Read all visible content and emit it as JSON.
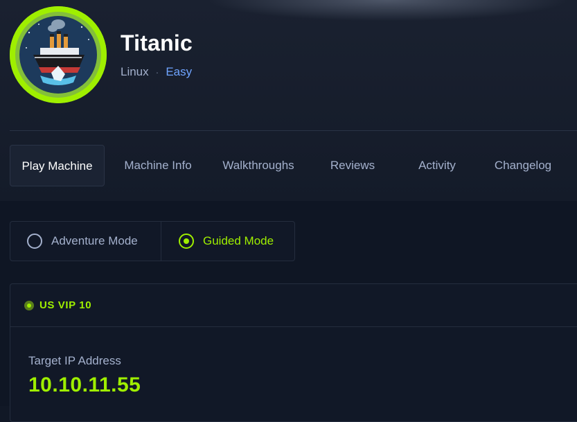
{
  "machine": {
    "name": "Titanic",
    "os": "Linux",
    "separator": "·",
    "difficulty": "Easy",
    "avatar_icon": "titanic-ship-icon"
  },
  "tabs": [
    {
      "label": "Play Machine",
      "active": true
    },
    {
      "label": "Machine Info",
      "active": false
    },
    {
      "label": "Walkthroughs",
      "active": false
    },
    {
      "label": "Reviews",
      "active": false
    },
    {
      "label": "Activity",
      "active": false
    },
    {
      "label": "Changelog",
      "active": false
    }
  ],
  "modes": {
    "adventure": {
      "label": "Adventure Mode",
      "selected": false
    },
    "guided": {
      "label": "Guided Mode",
      "selected": true
    }
  },
  "connection": {
    "server": "US VIP 10",
    "status_color": "#9fef00"
  },
  "target": {
    "label": "Target IP Address",
    "ip": "10.10.11.55"
  },
  "colors": {
    "accent": "#9fef00",
    "difficulty": "#6fa4ff",
    "background": "#111826"
  }
}
